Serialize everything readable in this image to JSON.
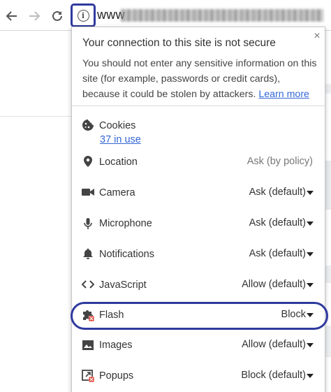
{
  "toolbar": {
    "url_prefix": "www"
  },
  "popup": {
    "close_glyph": "×",
    "title": "Your connection to this site is not secure",
    "description": "You should not enter any sensitive information on this site (for example, passwords or credit cards), because it could be stolen by attackers.",
    "learn_more": "Learn more",
    "cookies": {
      "label": "Cookies",
      "link": "37 in use"
    },
    "permissions": [
      {
        "label": "Location",
        "value": "Ask (by policy)",
        "icon": "location-pin-icon"
      },
      {
        "label": "Camera",
        "value": "Ask (default)",
        "icon": "camera-icon"
      },
      {
        "label": "Microphone",
        "value": "Ask (default)",
        "icon": "microphone-icon"
      },
      {
        "label": "Notifications",
        "value": "Ask (default)",
        "icon": "bell-icon"
      },
      {
        "label": "JavaScript",
        "value": "Allow (default)",
        "icon": "code-brackets-icon"
      },
      {
        "label": "Flash",
        "value": "Block",
        "icon": "plugin-blocked-icon"
      },
      {
        "label": "Images",
        "value": "Allow (default)",
        "icon": "image-icon"
      },
      {
        "label": "Popups",
        "value": "Block (default)",
        "icon": "popup-blocked-icon"
      }
    ]
  },
  "colors": {
    "highlight": "#2f3a9e",
    "link": "#3367d6",
    "blocked_red": "#d93025"
  }
}
